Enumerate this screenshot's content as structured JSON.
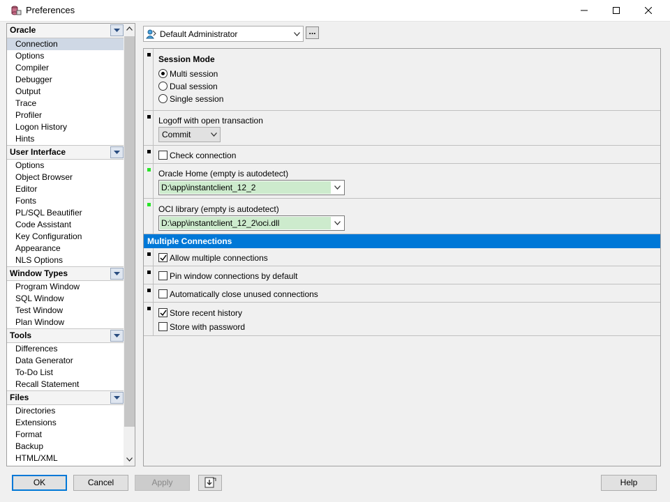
{
  "window": {
    "title": "Preferences",
    "icon": "database-icon"
  },
  "sidebar": {
    "groups": [
      {
        "label": "Oracle",
        "items": [
          "Connection",
          "Options",
          "Compiler",
          "Debugger",
          "Output",
          "Trace",
          "Profiler",
          "Logon History",
          "Hints"
        ]
      },
      {
        "label": "User Interface",
        "items": [
          "Options",
          "Object Browser",
          "Editor",
          "Fonts",
          "PL/SQL Beautifier",
          "Code Assistant",
          "Key Configuration",
          "Appearance",
          "NLS Options"
        ]
      },
      {
        "label": "Window Types",
        "items": [
          "Program Window",
          "SQL Window",
          "Test Window",
          "Plan Window"
        ]
      },
      {
        "label": "Tools",
        "items": [
          "Differences",
          "Data Generator",
          "To-Do List",
          "Recall Statement"
        ]
      },
      {
        "label": "Files",
        "items": [
          "Directories",
          "Extensions",
          "Format",
          "Backup",
          "HTML/XML"
        ]
      }
    ],
    "selected": "Connection"
  },
  "profile": {
    "value": "Default Administrator",
    "more_label": "..."
  },
  "session_mode": {
    "title": "Session Mode",
    "options": [
      "Multi session",
      "Dual session",
      "Single session"
    ],
    "selected": "Multi session"
  },
  "logoff": {
    "label": "Logoff with open transaction",
    "value": "Commit"
  },
  "check_connection": {
    "label": "Check connection",
    "checked": false
  },
  "oracle_home": {
    "label": "Oracle Home (empty is autodetect)",
    "value": "D:\\app\\instantclient_12_2"
  },
  "oci_library": {
    "label": "OCI library (empty is autodetect)",
    "value": "D:\\app\\instantclient_12_2\\oci.dll"
  },
  "multiple_connections": {
    "header": "Multiple Connections",
    "allow_multiple": {
      "label": "Allow multiple connections",
      "checked": true
    },
    "pin_window": {
      "label": "Pin window connections by default",
      "checked": false
    },
    "auto_close": {
      "label": "Automatically close unused connections",
      "checked": false
    },
    "store_history": {
      "label": "Store recent history",
      "checked": true
    },
    "store_password": {
      "label": "Store with password",
      "checked": false
    }
  },
  "buttons": {
    "ok": "OK",
    "cancel": "Cancel",
    "apply": "Apply",
    "help": "Help"
  }
}
